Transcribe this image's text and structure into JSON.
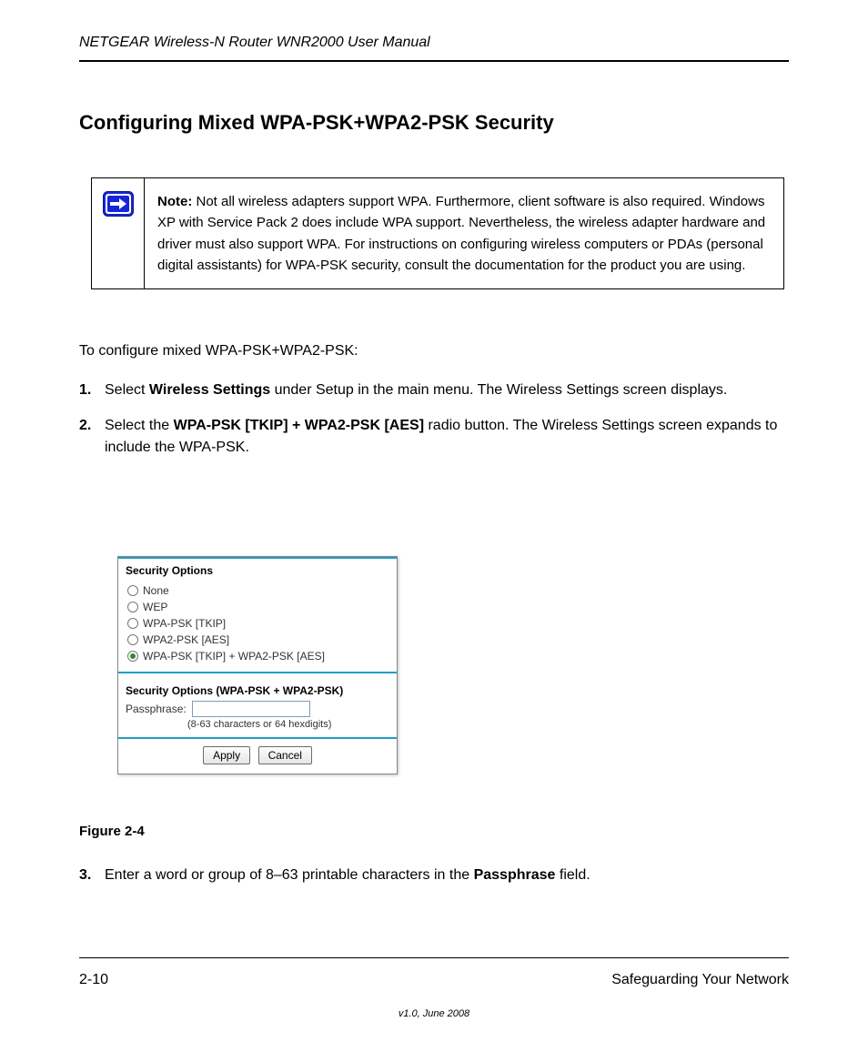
{
  "header": {
    "title": "NETGEAR Wireless-N Router WNR2000 User Manual"
  },
  "section_heading": "Configuring Mixed WPA-PSK+WPA2-PSK Security",
  "note": {
    "label": "Note:",
    "text_parts": {
      "p1a": "Not all wireless adapters support WPA. Furthermore, client software is also required. Windows XP with Service Pack 2 does include WPA support. Nevertheless, the wireless adapter hardware and driver must also support WPA. For instructions on configuring wireless computers or PDAs (personal digital assistants) for WPA-PSK security, consult the documentation for the product you are using."
    }
  },
  "body": {
    "intro": "To configure mixed WPA-PSK+WPA2-PSK:",
    "step1_num": "1.",
    "step1_a": "Select ",
    "step1_b": "Wireless Settings",
    "step1_c": " under Setup in the main menu. The Wireless Settings screen displays.",
    "step2_num": "2.",
    "step2_a": "Select the ",
    "step2_b": "WPA-PSK [TKIP] + WPA2-PSK [AES]",
    "step2_c": " radio button. The Wireless Settings screen expands to include the WPA-PSK."
  },
  "panel": {
    "title": "Security Options",
    "options": {
      "none": "None",
      "wep": "WEP",
      "wpa_tkip": "WPA-PSK [TKIP]",
      "wpa2_aes": "WPA2-PSK [AES]",
      "mixed": "WPA-PSK [TKIP] + WPA2-PSK [AES]"
    },
    "sub_title": "Security Options (WPA-PSK + WPA2-PSK)",
    "passphrase_label": "Passphrase:",
    "passphrase_hint": "(8-63 characters or 64 hexdigits)",
    "apply": "Apply",
    "cancel": "Cancel"
  },
  "figure_caption": "Figure 2-4",
  "step3": {
    "num": "3.",
    "a": "Enter a word or group of 8–63 printable characters in the ",
    "b": "Passphrase",
    "c": " field."
  },
  "footer": {
    "page": "2-10",
    "chapter": "Safeguarding Your Network",
    "version": "v1.0, June 2008"
  }
}
